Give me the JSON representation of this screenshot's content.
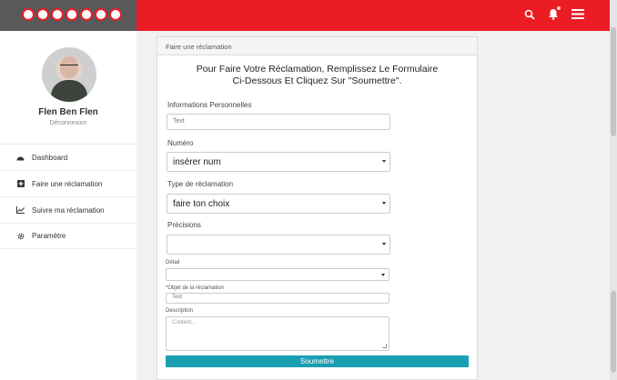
{
  "header": {
    "brand": "ooredoo",
    "colors": {
      "brand_red": "#ec1c24",
      "brand_grey": "#58595b",
      "accent_button": "#1b9fb2"
    },
    "icons": [
      "search-icon",
      "bell-icon",
      "menu-icon"
    ]
  },
  "sidebar": {
    "user_name": "Flen Ben Flen",
    "logout_label": "Déconnexion",
    "items": [
      {
        "label": "Dashboard",
        "icon": "dashboard-icon"
      },
      {
        "label": "Faire une réclamation",
        "icon": "plus-square-icon"
      },
      {
        "label": "Suivre ma réclamation",
        "icon": "chart-icon"
      },
      {
        "label": "Paramètre",
        "icon": "gear-icon"
      }
    ]
  },
  "panel": {
    "breadcrumb": "Faire une réclamation",
    "title_line1": "Pour Faire Votre Réclamation, Remplissez Le Formulaire",
    "title_line2": "Ci-Dessous Et Cliquez Sur \"Soumettre\".",
    "fields": {
      "personal_label": "Informations Personnelles",
      "personal_value": "Text",
      "numero_label": "Numéro",
      "numero_value": "insérer num",
      "type_label": "Type de réclamation",
      "type_value": "faire ton choix",
      "precisions_label": "Précisions",
      "precisions_value": "",
      "detail_label": "Détail",
      "detail_value": "",
      "objet_label": "*Objet de la réclamation",
      "objet_value": "Text",
      "description_label": "Description",
      "description_placeholder": "Content..."
    },
    "submit_label": "Soumettre"
  }
}
